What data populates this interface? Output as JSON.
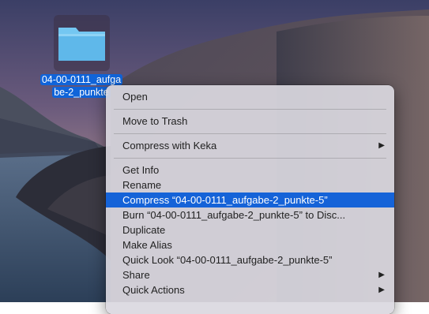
{
  "desktop": {
    "folder": {
      "icon": "folder-icon",
      "label_line1": "04-00-0111_aufga",
      "label_line2": "be-2_punkte"
    }
  },
  "context_menu": {
    "items": [
      {
        "label": "Open"
      },
      {
        "label": "Move to Trash"
      },
      {
        "label": "Compress with Keka",
        "submenu": true
      },
      {
        "label": "Get Info"
      },
      {
        "label": "Rename"
      },
      {
        "label": "Compress “04-00-0111_aufgabe-2_punkte-5”",
        "highlighted": true
      },
      {
        "label": "Burn “04-00-0111_aufgabe-2_punkte-5” to Disc..."
      },
      {
        "label": "Duplicate"
      },
      {
        "label": "Make Alias"
      },
      {
        "label": "Quick Look “04-00-0111_aufgabe-2_punkte-5”"
      },
      {
        "label": "Share",
        "submenu": true
      },
      {
        "label": "Quick Actions",
        "submenu": true
      }
    ],
    "submenu_glyph": "▶",
    "highlight_color": "#1563d8"
  }
}
